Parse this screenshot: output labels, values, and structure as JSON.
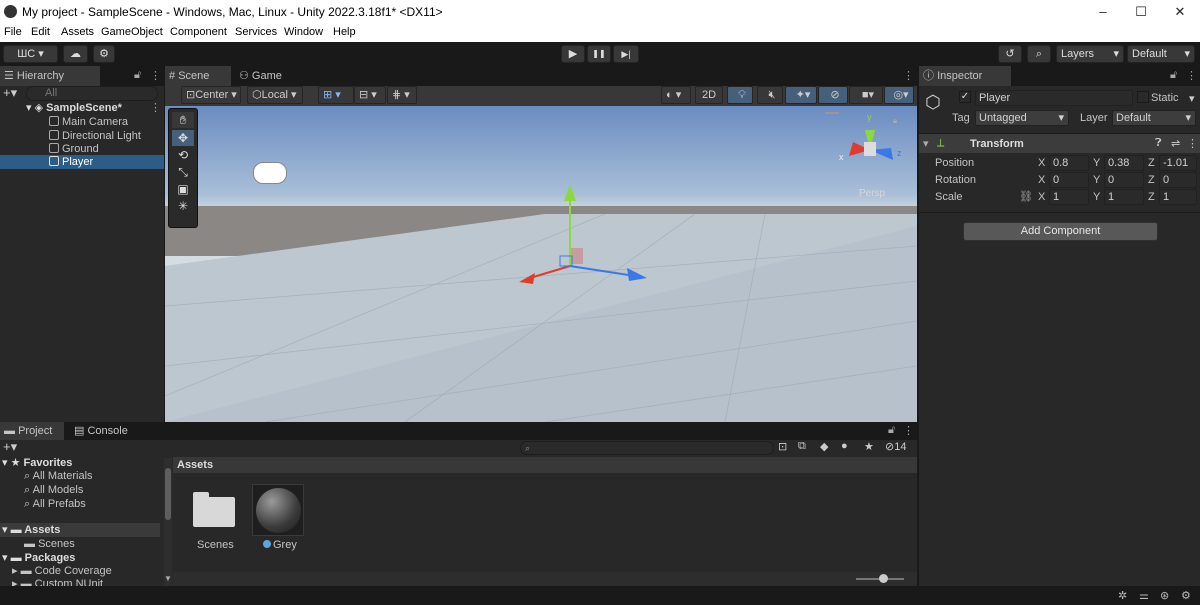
{
  "window": {
    "title": "My project - SampleScene - Windows, Mac, Linux - Unity 2022.3.18f1* <DX11>",
    "min": "–",
    "max": "☐",
    "close": "✕"
  },
  "menu": [
    "File",
    "Edit",
    "Assets",
    "GameObject",
    "Component",
    "Services",
    "Window",
    "Help"
  ],
  "toolbar": {
    "account": "ШС ▾",
    "layers": "Layers",
    "layout": "Default",
    "play": "▶",
    "pause": "❚❚",
    "step": "▶|"
  },
  "hierarchy": {
    "tab": "Hierarchy",
    "search_placeholder": "All",
    "scene": "SampleScene*",
    "items": [
      "Main Camera",
      "Directional Light",
      "Ground",
      "Player"
    ]
  },
  "scene_tabs": {
    "scene": "Scene",
    "game": "Game"
  },
  "scene_toolbar": {
    "pivot": "Center",
    "space": "Local",
    "mode2d": "2D"
  },
  "scene_view": {
    "persp": "Persp",
    "axis_x": "x",
    "axis_y": "y",
    "axis_z": "z"
  },
  "inspector": {
    "tab": "Inspector",
    "object_name": "Player",
    "static_label": "Static",
    "tag_label": "Tag",
    "tag_value": "Untagged",
    "layer_label": "Layer",
    "layer_value": "Default",
    "component": "Transform",
    "position": {
      "label": "Position",
      "x": "0.8",
      "y": "0.38",
      "z": "-1.01"
    },
    "rotation": {
      "label": "Rotation",
      "x": "0",
      "y": "0",
      "z": "0"
    },
    "scale": {
      "label": "Scale",
      "x": "1",
      "y": "1",
      "z": "1"
    },
    "axis": {
      "x": "X",
      "y": "Y",
      "z": "Z"
    },
    "add_component": "Add Component"
  },
  "project": {
    "tab_project": "Project",
    "tab_console": "Console",
    "favorites": "Favorites",
    "fav_items": [
      "All Materials",
      "All Models",
      "All Prefabs"
    ],
    "assets": "Assets",
    "asset_children": [
      "Scenes"
    ],
    "packages": "Packages",
    "package_children": [
      "Code Coverage",
      "Custom NUnit"
    ],
    "breadcrumb": "Assets",
    "hidden_count": "14",
    "grid_items": [
      {
        "name": "Scenes"
      },
      {
        "name": "Grey"
      }
    ]
  }
}
